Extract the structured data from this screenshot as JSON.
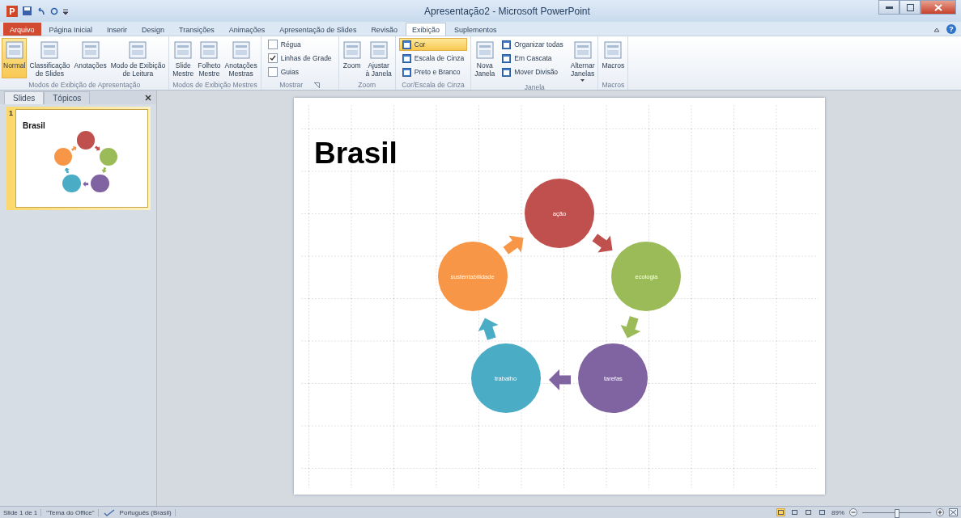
{
  "window": {
    "app_letter": "P",
    "title": "Apresentação2 - Microsoft PowerPoint"
  },
  "tabs": [
    {
      "label": "Arquivo",
      "kind": "file",
      "selected": false
    },
    {
      "label": "Página Inicial",
      "kind": "tab",
      "selected": false
    },
    {
      "label": "Inserir",
      "kind": "tab",
      "selected": false
    },
    {
      "label": "Design",
      "kind": "tab",
      "selected": false
    },
    {
      "label": "Transições",
      "kind": "tab",
      "selected": false
    },
    {
      "label": "Animações",
      "kind": "tab",
      "selected": false
    },
    {
      "label": "Apresentação de Slides",
      "kind": "tab",
      "selected": false
    },
    {
      "label": "Revisão",
      "kind": "tab",
      "selected": false
    },
    {
      "label": "Exibição",
      "kind": "tab",
      "selected": true
    },
    {
      "label": "Suplementos",
      "kind": "tab",
      "selected": false
    }
  ],
  "help": "?",
  "ribbon": [
    {
      "label": "Modos de Exibição de Apresentação",
      "launcher": false,
      "controls": [
        {
          "kind": "large",
          "label": "Normal",
          "selected": true
        },
        {
          "kind": "large",
          "label": "Classificação\nde Slides",
          "selected": false
        },
        {
          "kind": "large",
          "label": "Anotações",
          "selected": false
        },
        {
          "kind": "large",
          "label": "Modo de Exibição\nde Leitura",
          "selected": false
        }
      ]
    },
    {
      "label": "Modos de Exibição Mestres",
      "launcher": false,
      "controls": [
        {
          "kind": "large",
          "label": "Slide\nMestre"
        },
        {
          "kind": "large",
          "label": "Folheto\nMestre"
        },
        {
          "kind": "large",
          "label": "Anotações\nMestras"
        }
      ]
    },
    {
      "label": "Mostrar",
      "launcher": true,
      "controls": [
        {
          "kind": "check",
          "label": "Régua",
          "checked": false
        },
        {
          "kind": "check",
          "label": "Linhas de Grade",
          "checked": true
        },
        {
          "kind": "check",
          "label": "Guias",
          "checked": false
        }
      ]
    },
    {
      "label": "Zoom",
      "launcher": false,
      "controls": [
        {
          "kind": "large",
          "label": "Zoom"
        },
        {
          "kind": "large",
          "label": "Ajustar\nà Janela"
        }
      ]
    },
    {
      "label": "Cor/Escala de Cinza",
      "launcher": false,
      "controls": [
        {
          "kind": "small",
          "label": "Cor",
          "selected": true
        },
        {
          "kind": "small",
          "label": "Escala de Cinza",
          "selected": false
        },
        {
          "kind": "small",
          "label": "Preto e Branco",
          "selected": false
        }
      ]
    },
    {
      "label": "Janela",
      "launcher": false,
      "controls": [
        {
          "kind": "large",
          "label": "Nova\nJanela"
        },
        {
          "kind": "small",
          "label": "Organizar todas"
        },
        {
          "kind": "small",
          "label": "Em Cascata"
        },
        {
          "kind": "small",
          "label": "Mover Divisão"
        },
        {
          "kind": "large",
          "label": "Alternar\nJanelas",
          "dropdown": true
        }
      ]
    },
    {
      "label": "Macros",
      "launcher": false,
      "controls": [
        {
          "kind": "large",
          "label": "Macros"
        }
      ]
    }
  ],
  "panel": {
    "tabs": [
      {
        "label": "Slides",
        "selected": true
      },
      {
        "label": "Tópicos",
        "selected": false
      }
    ],
    "thumbnails": [
      {
        "number": "1",
        "title": "Brasil",
        "selected": true
      }
    ]
  },
  "slide": {
    "title": "Brasil",
    "gridlines": true,
    "nodes": [
      {
        "label": "ação",
        "color": "#c0504d"
      },
      {
        "label": "ecologia",
        "color": "#9bbb59"
      },
      {
        "label": "tarefas",
        "color": "#8064a2"
      },
      {
        "label": "trabalho",
        "color": "#4bacc6"
      },
      {
        "label": "sustentabilidade",
        "color": "#f79646"
      }
    ]
  },
  "status_bar": {
    "slide": "Slide 1 de 1",
    "theme": "\"Tema do Office\"",
    "language": "Português (Brasil)",
    "views": [
      {
        "selected": true
      },
      {
        "selected": false
      },
      {
        "selected": false
      },
      {
        "selected": false
      }
    ],
    "zoom": "89%",
    "zoom_slider": {
      "level": 0.5
    }
  }
}
